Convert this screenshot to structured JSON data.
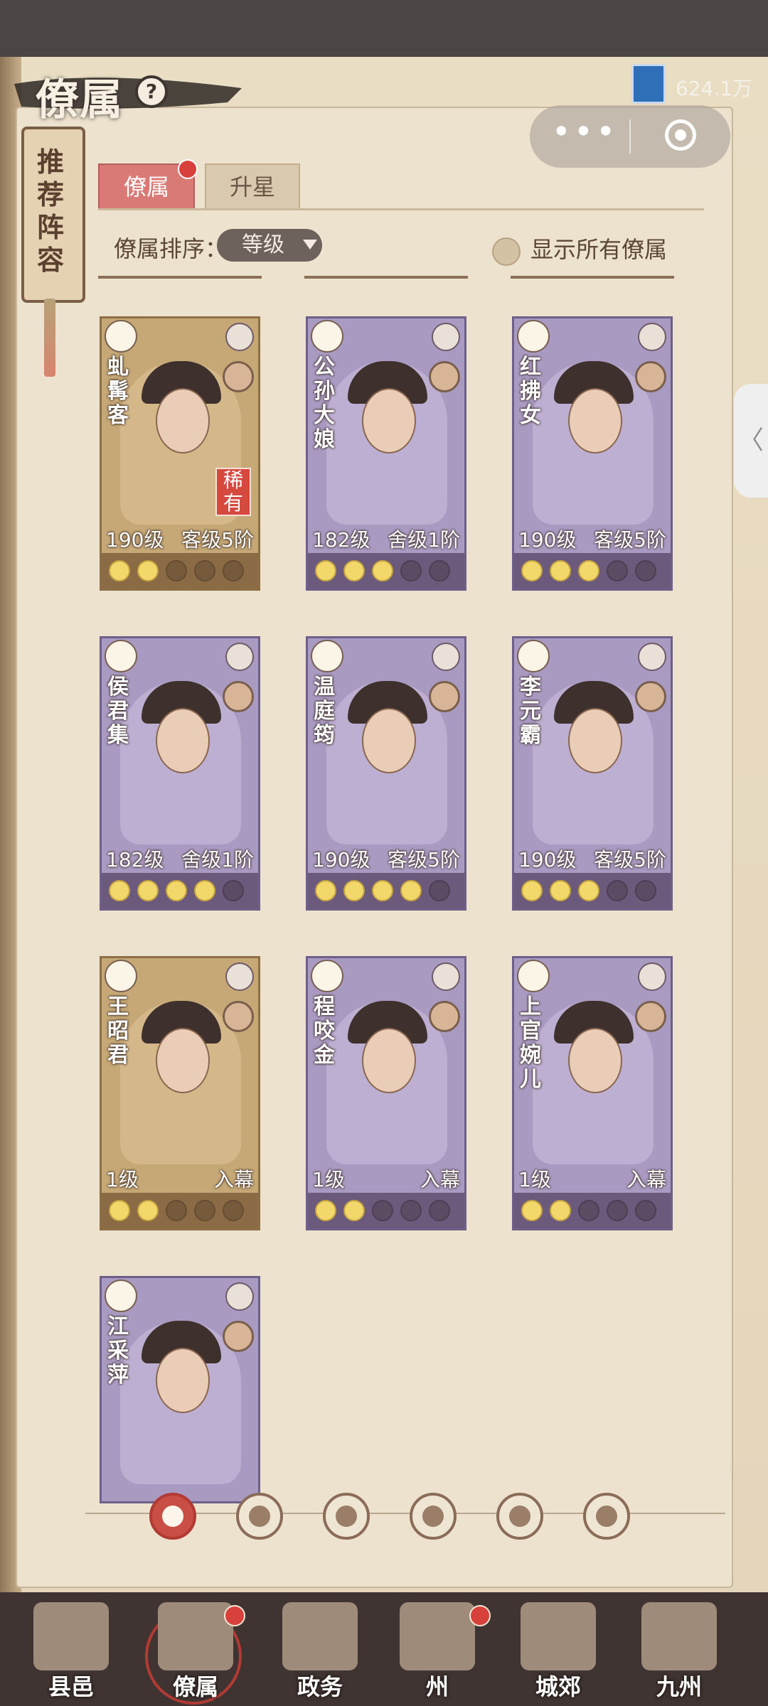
{
  "header": {
    "title": "僚属",
    "help_label": "?",
    "currency_value": "624.1万"
  },
  "mini_program": {
    "more_label": "•••"
  },
  "recommend": {
    "label": "推荐阵容"
  },
  "tabs": [
    {
      "label": "僚属",
      "active": true,
      "has_dot": true
    },
    {
      "label": "升星",
      "active": false
    }
  ],
  "sort": {
    "label": "僚属排序：",
    "value": "等级",
    "show_all_label": "显示所有僚属"
  },
  "cards": [
    {
      "name": "虬髯客",
      "level": "190级",
      "rank": "客级5阶",
      "rare": "稀有",
      "stars_on": 2,
      "stars_total": 5,
      "theme": "gold",
      "type_icon": "gourd-icon",
      "skill_icon": "shield-icon"
    },
    {
      "name": "公孙大娘",
      "level": "182级",
      "rank": "舍级1阶",
      "rare": "",
      "stars_on": 3,
      "stars_total": 5,
      "theme": "purple",
      "type_icon": "fan-icon",
      "skill_icon": "sword-icon"
    },
    {
      "name": "红拂女",
      "level": "190级",
      "rank": "客级5阶",
      "rare": "",
      "stars_on": 3,
      "stars_total": 5,
      "theme": "purple",
      "type_icon": "fan-icon",
      "skill_icon": "yinyang-icon"
    },
    {
      "name": "侯君集",
      "level": "182级",
      "rank": "舍级1阶",
      "rare": "",
      "stars_on": 4,
      "stars_total": 5,
      "theme": "purple",
      "type_icon": "gourd-icon",
      "skill_icon": "sword-icon"
    },
    {
      "name": "温庭筠",
      "level": "190级",
      "rank": "客级5阶",
      "rare": "",
      "stars_on": 4,
      "stars_total": 5,
      "theme": "purple",
      "type_icon": "bell-icon",
      "skill_icon": "yinyang-icon"
    },
    {
      "name": "李元霸",
      "level": "190级",
      "rank": "客级5阶",
      "rare": "",
      "stars_on": 3,
      "stars_total": 5,
      "theme": "purple",
      "type_icon": "bell-icon",
      "skill_icon": "shield-icon"
    },
    {
      "name": "王昭君",
      "level": "1级",
      "rank": "入幕",
      "rare": "",
      "stars_on": 2,
      "stars_total": 5,
      "theme": "gold",
      "type_icon": "gourd-icon",
      "skill_icon": "yinyang-icon"
    },
    {
      "name": "程咬金",
      "level": "1级",
      "rank": "入幕",
      "rare": "",
      "stars_on": 2,
      "stars_total": 5,
      "theme": "purple",
      "type_icon": "beast-icon",
      "skill_icon": "shield-icon"
    },
    {
      "name": "上官婉儿",
      "level": "1级",
      "rank": "入幕",
      "rare": "",
      "stars_on": 2,
      "stars_total": 5,
      "theme": "purple",
      "type_icon": "beast-icon",
      "skill_icon": "cloud-icon"
    },
    {
      "name": "江采萍",
      "level": "",
      "rank": "",
      "rare": "",
      "stars_on": 0,
      "stars_total": 5,
      "theme": "purple",
      "type_icon": "gourd-icon",
      "skill_icon": "cloud-icon"
    }
  ],
  "filters": [
    {
      "name": "all-filter",
      "icon": "flower-icon",
      "active": true
    },
    {
      "name": "bell-filter",
      "icon": "bell-icon",
      "active": false
    },
    {
      "name": "gourd-filter",
      "icon": "gourd-icon",
      "active": false
    },
    {
      "name": "fan-filter",
      "icon": "fan-icon",
      "active": false
    },
    {
      "name": "beast-filter",
      "icon": "beast-icon",
      "active": false
    },
    {
      "name": "leaf-filter",
      "icon": "leaf-icon",
      "active": false
    }
  ],
  "side_tab": {
    "label": "〈"
  },
  "nav": [
    {
      "label": "县邑",
      "active": false,
      "has_dot": false
    },
    {
      "label": "僚属",
      "active": true,
      "has_dot": true
    },
    {
      "label": "政务",
      "active": false,
      "has_dot": false
    },
    {
      "label": "州",
      "active": false,
      "has_dot": true
    },
    {
      "label": "城郊",
      "active": false,
      "has_dot": false
    },
    {
      "label": "九州",
      "active": false,
      "has_dot": false
    }
  ],
  "colors": {
    "accent": "#d97a76",
    "alert": "#d8403c",
    "gold_card": "#c6a877",
    "purple_card": "#a99ac2"
  }
}
